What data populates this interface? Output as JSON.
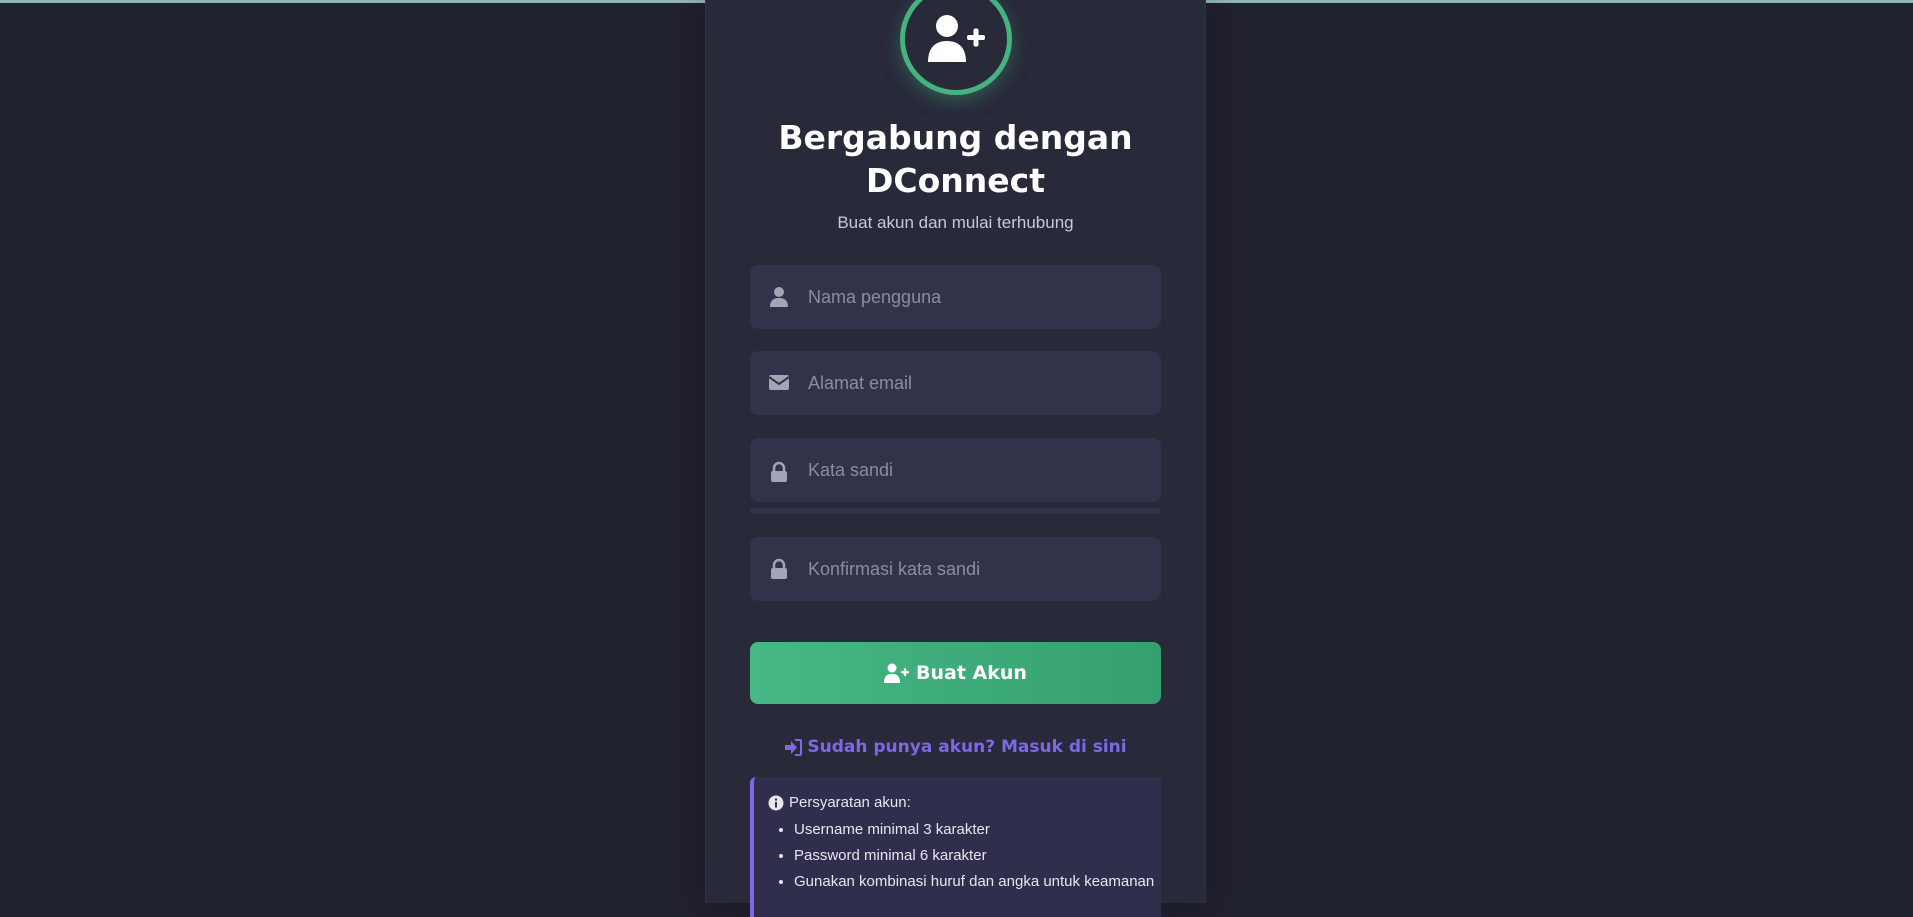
{
  "header": {
    "title": "Bergabung dengan DConnect",
    "subtitle": "Buat akun dan mulai terhubung",
    "avatar_icon": "user-plus-icon"
  },
  "form": {
    "username": {
      "placeholder": "Nama pengguna",
      "value": "",
      "icon": "user-icon"
    },
    "email": {
      "placeholder": "Alamat email",
      "value": "",
      "icon": "envelope-icon"
    },
    "password": {
      "placeholder": "Kata sandi",
      "value": "",
      "icon": "lock-icon"
    },
    "confirm_password": {
      "placeholder": "Konfirmasi kata sandi",
      "value": "",
      "icon": "lock-icon"
    },
    "password_strength": 0,
    "submit_label": "Buat Akun",
    "submit_icon": "user-plus-icon"
  },
  "login_link": {
    "label": "Sudah punya akun? Masuk di sini",
    "icon": "sign-in-icon"
  },
  "requirements": {
    "title": "Persyaratan akun:",
    "icon": "info-circle-icon",
    "items": [
      "Username minimal 3 karakter",
      "Password minimal 6 karakter",
      "Gunakan kombinasi huruf dan angka untuk keamanan"
    ]
  },
  "colors": {
    "accent_green": "#44b37f",
    "accent_purple": "#7d68e6",
    "background": "#21222f",
    "card": "#282939",
    "field": "#32334a"
  }
}
